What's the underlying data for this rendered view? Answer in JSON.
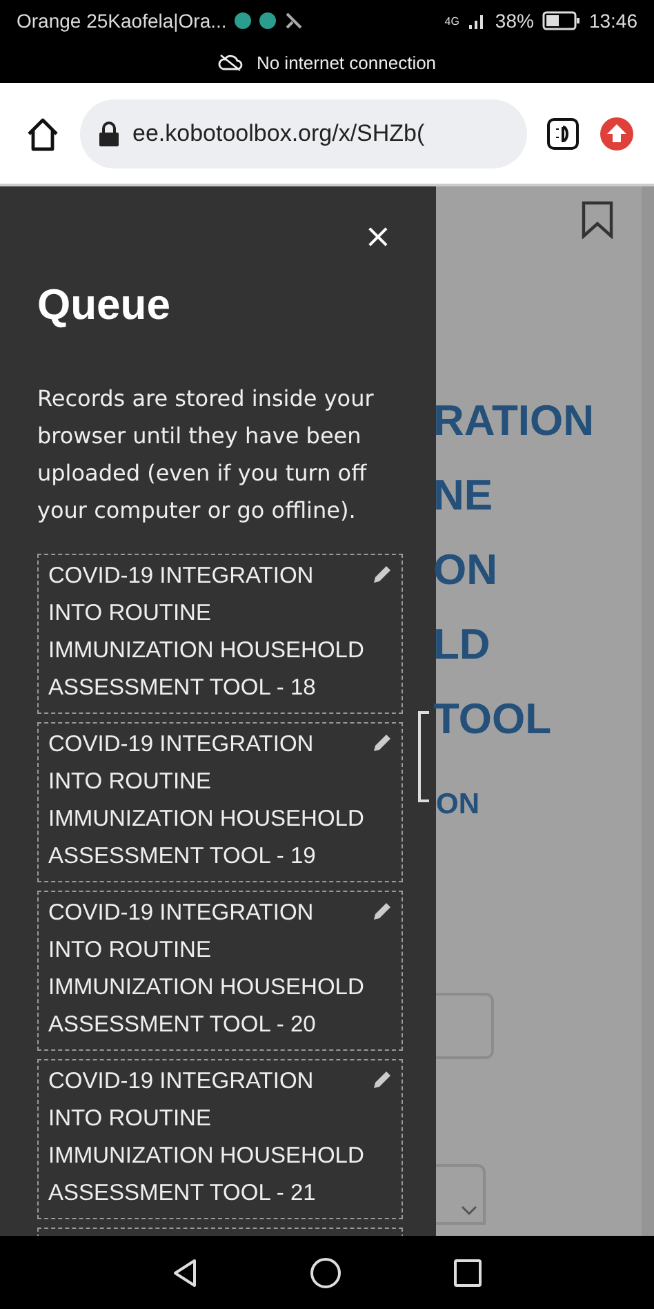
{
  "status_bar": {
    "carrier": "Orange 25Kaofela|Ora...",
    "network": "4G",
    "battery": "38%",
    "time": "13:46"
  },
  "notice": {
    "text": "No internet connection"
  },
  "browser": {
    "url": "ee.kobotoolbox.org/x/SHZb("
  },
  "page": {
    "title_lines": [
      "RATION",
      "NE",
      "ON",
      "LD",
      "TOOL"
    ],
    "subtitle": "ON"
  },
  "drawer": {
    "close": "×",
    "title": "Queue",
    "description": "Records are stored inside your browser until they have been uploaded (even if you turn off your computer or go offline).",
    "records": [
      {
        "name": "COVID-19 INTEGRATION INTO ROUTINE IMMUNIZATION HOUSEHOLD ASSESSMENT TOOL - 18"
      },
      {
        "name": "COVID-19 INTEGRATION INTO ROUTINE IMMUNIZATION HOUSEHOLD ASSESSMENT TOOL - 19"
      },
      {
        "name": "COVID-19 INTEGRATION INTO ROUTINE IMMUNIZATION HOUSEHOLD ASSESSMENT TOOL - 20"
      },
      {
        "name": "COVID-19 INTEGRATION INTO ROUTINE IMMUNIZATION HOUSEHOLD ASSESSMENT TOOL - 21"
      }
    ]
  }
}
